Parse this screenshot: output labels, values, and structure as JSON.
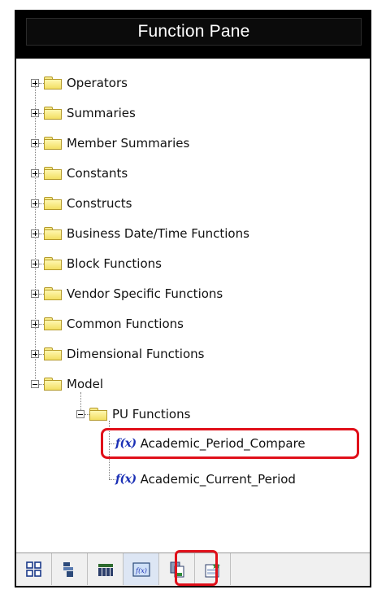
{
  "pane": {
    "title": "Function Pane"
  },
  "tree": {
    "folders": [
      {
        "label": "Operators",
        "expanded": false
      },
      {
        "label": "Summaries",
        "expanded": false
      },
      {
        "label": "Member Summaries",
        "expanded": false
      },
      {
        "label": "Constants",
        "expanded": false
      },
      {
        "label": "Constructs",
        "expanded": false
      },
      {
        "label": "Business Date/Time Functions",
        "expanded": false
      },
      {
        "label": "Block Functions",
        "expanded": false
      },
      {
        "label": "Vendor Specific Functions",
        "expanded": false
      },
      {
        "label": "Common Functions",
        "expanded": false
      },
      {
        "label": "Dimensional Functions",
        "expanded": false
      },
      {
        "label": "Model",
        "expanded": true
      }
    ],
    "subfolder": {
      "label": "PU Functions",
      "expanded": true
    },
    "functions": [
      {
        "label": "Academic_Period_Compare",
        "icon": "function-fx-icon",
        "highlighted": true
      },
      {
        "label": "Academic_Current_Period",
        "icon": "function-fx-icon",
        "highlighted": false
      }
    ]
  },
  "toolbar": {
    "buttons": [
      {
        "icon": "data-items-icon"
      },
      {
        "icon": "query-tree-icon"
      },
      {
        "icon": "table-icon"
      },
      {
        "icon": "function-pane-icon",
        "active": true
      },
      {
        "icon": "copy-icon"
      },
      {
        "icon": "new-item-icon"
      }
    ]
  },
  "colors": {
    "highlight": "#e0101a",
    "title_bg": "#000000",
    "folder": "#f2df62",
    "fx": "#1a2fb5"
  }
}
